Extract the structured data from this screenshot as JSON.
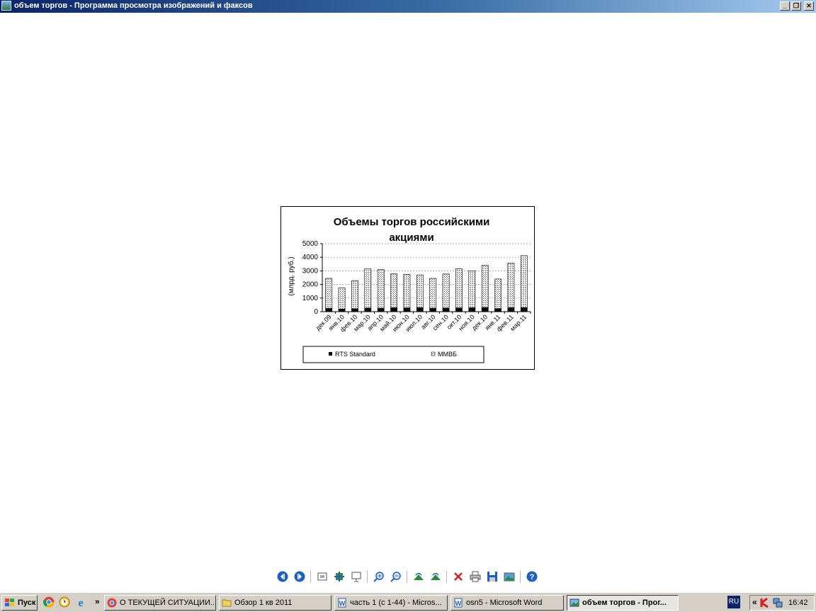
{
  "window": {
    "title": "объем торгов - Программа просмотра изображений и факсов",
    "minimize_glyph": "_",
    "restore_glyph": "❐",
    "close_glyph": "✕"
  },
  "chart_data": {
    "type": "bar",
    "stacked": true,
    "title_line1": "Объемы торгов российскими",
    "title_line2": "акциями",
    "xlabel": "",
    "ylabel": "(млрд. руб.)",
    "ylim": [
      0,
      5000
    ],
    "yticks": [
      "0",
      "1000",
      "2000",
      "3000",
      "4000",
      "5000"
    ],
    "grid": "horizontal dashed",
    "legend_position": "bottom",
    "categories": [
      "дек.09",
      "янв.10",
      "фев.10",
      "мар.10",
      "апр.10",
      "май.10",
      "июн.10",
      "июл.10",
      "авг.10",
      "сен.10",
      "окт.10",
      "ноя.10",
      "дек.10",
      "янв.11",
      "фев.11",
      "мар.11"
    ],
    "series": [
      {
        "name": "RTS Standard",
        "color": "#000000",
        "values": [
          250,
          200,
          220,
          270,
          260,
          290,
          280,
          300,
          260,
          270,
          280,
          290,
          310,
          230,
          290,
          300
        ]
      },
      {
        "name": "ММВБ",
        "color": "#cccccc",
        "values": [
          2200,
          1550,
          2060,
          2880,
          2840,
          2490,
          2460,
          2400,
          2190,
          2500,
          2880,
          2710,
          3090,
          2170,
          3280,
          3820
        ]
      }
    ]
  },
  "toolbar": [
    {
      "name": "previous-image-button",
      "icon": "prev-icon"
    },
    {
      "name": "next-image-button",
      "icon": "next-icon"
    },
    {
      "name": "best-fit-button",
      "icon": "best-fit-icon"
    },
    {
      "name": "actual-size-button",
      "icon": "actual-size-icon"
    },
    {
      "name": "slideshow-button",
      "icon": "slideshow-icon"
    },
    {
      "name": "zoom-in-button",
      "icon": "zoom-in-icon"
    },
    {
      "name": "zoom-out-button",
      "icon": "zoom-out-icon"
    },
    {
      "name": "rotate-clockwise-button",
      "icon": "rotate-cw-icon"
    },
    {
      "name": "rotate-counterclockwise-button",
      "icon": "rotate-ccw-icon"
    },
    {
      "name": "delete-button",
      "icon": "delete-icon"
    },
    {
      "name": "print-button",
      "icon": "print-icon"
    },
    {
      "name": "save-button",
      "icon": "save-icon"
    },
    {
      "name": "edit-button",
      "icon": "edit-icon"
    },
    {
      "name": "help-button",
      "icon": "help-icon"
    }
  ],
  "taskbar": {
    "start_label": "Пуск",
    "chevron": "»",
    "tasks": [
      {
        "label": "О ТЕКУЩЕЙ СИТУАЦИИ...",
        "icon": "chrome-icon",
        "active": false
      },
      {
        "label": "Обзор 1 кв 2011",
        "icon": "folder-icon",
        "active": false
      },
      {
        "label": "часть 1 (с 1-44) - Micros...",
        "icon": "word-icon",
        "active": false
      },
      {
        "label": "osn5 - Microsoft Word",
        "icon": "word-icon",
        "active": false
      },
      {
        "label": "объем торгов - Прог...",
        "icon": "image-viewer-icon",
        "active": true
      }
    ],
    "language": "RU",
    "tray_chevron": "«",
    "clock": "16:42"
  }
}
